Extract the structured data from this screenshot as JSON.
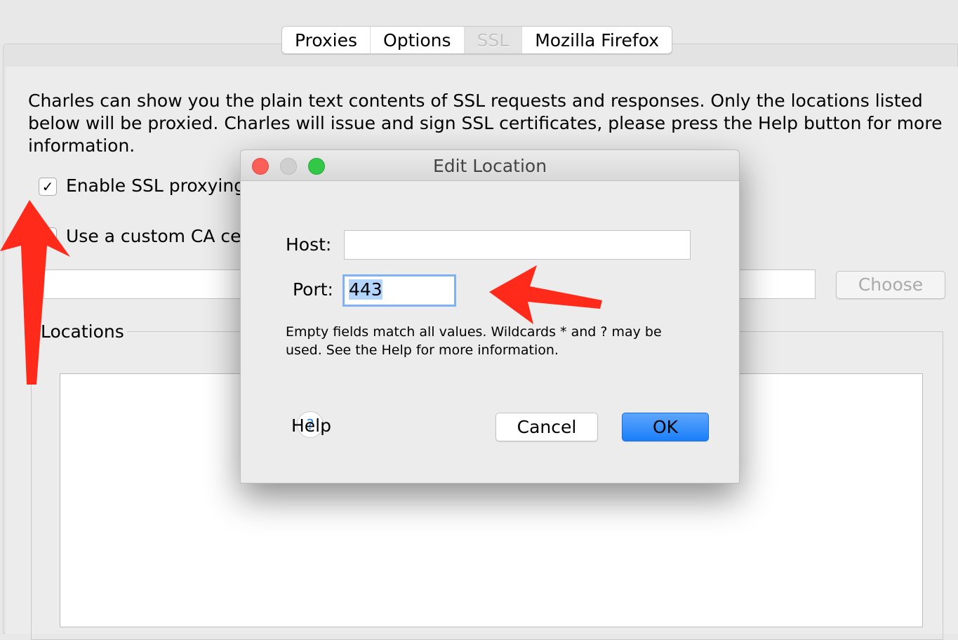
{
  "tabs": [
    {
      "label": "Proxies"
    },
    {
      "label": "Options"
    },
    {
      "label": "SSL",
      "selected": true
    },
    {
      "label": "Mozilla Firefox"
    }
  ],
  "ssl": {
    "description": "Charles can show you the plain text contents of SSL requests and responses. Only the locations listed below will be proxied. Charles will issue and sign SSL certificates, please press the Help button for more information.",
    "enable_label": "Enable SSL proxying",
    "enable_checked": true,
    "custom_ca_label": "Use a custom CA ce",
    "custom_ca_checked": false,
    "choose_label": "Choose",
    "locations_label": "Locations"
  },
  "dialog": {
    "title": "Edit Location",
    "host_label": "Host:",
    "host_value": "",
    "port_label": "Port:",
    "port_value": "443",
    "hint": "Empty fields match all values. Wildcards * and ? may be used. See the Help for more information.",
    "help_label": "Help",
    "help_icon": "?",
    "cancel_label": "Cancel",
    "ok_label": "OK"
  },
  "colors": {
    "accent": "#1a82fb",
    "annotation_arrow": "#ff2a1a",
    "close": "#fc5f57",
    "minimize": "#cfcfcf",
    "zoom": "#33c748"
  }
}
